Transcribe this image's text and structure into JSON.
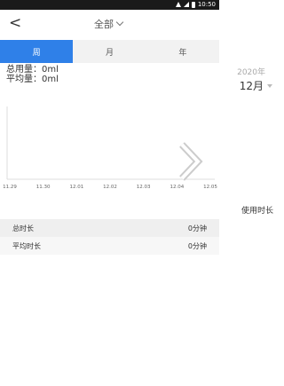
{
  "status_bar": {
    "time": "10:50"
  },
  "nav": {
    "back_glyph": "<",
    "title": "全部"
  },
  "tabs": [
    {
      "label": "周",
      "active": true
    },
    {
      "label": "月",
      "active": false
    },
    {
      "label": "年",
      "active": false
    }
  ],
  "stats": {
    "total_label": "总用量：",
    "total_value": "0ml",
    "avg_label": "平均量：",
    "avg_value": "0ml"
  },
  "date_picker": {
    "year": "2020年",
    "month": "12月"
  },
  "chart_data": {
    "type": "line",
    "x": [
      "11.29",
      "11.30",
      "12.01",
      "12.02",
      "12.03",
      "12.04",
      "12.05"
    ],
    "series": [],
    "ylabel": "",
    "xlabel": ""
  },
  "usage_label": "使用时长",
  "summary": [
    {
      "label": "总时长",
      "value": "0分钟"
    },
    {
      "label": "平均时长",
      "value": "0分钟"
    }
  ],
  "colors": {
    "accent": "#2f80e8",
    "status_bar": "#1a1a1a"
  }
}
